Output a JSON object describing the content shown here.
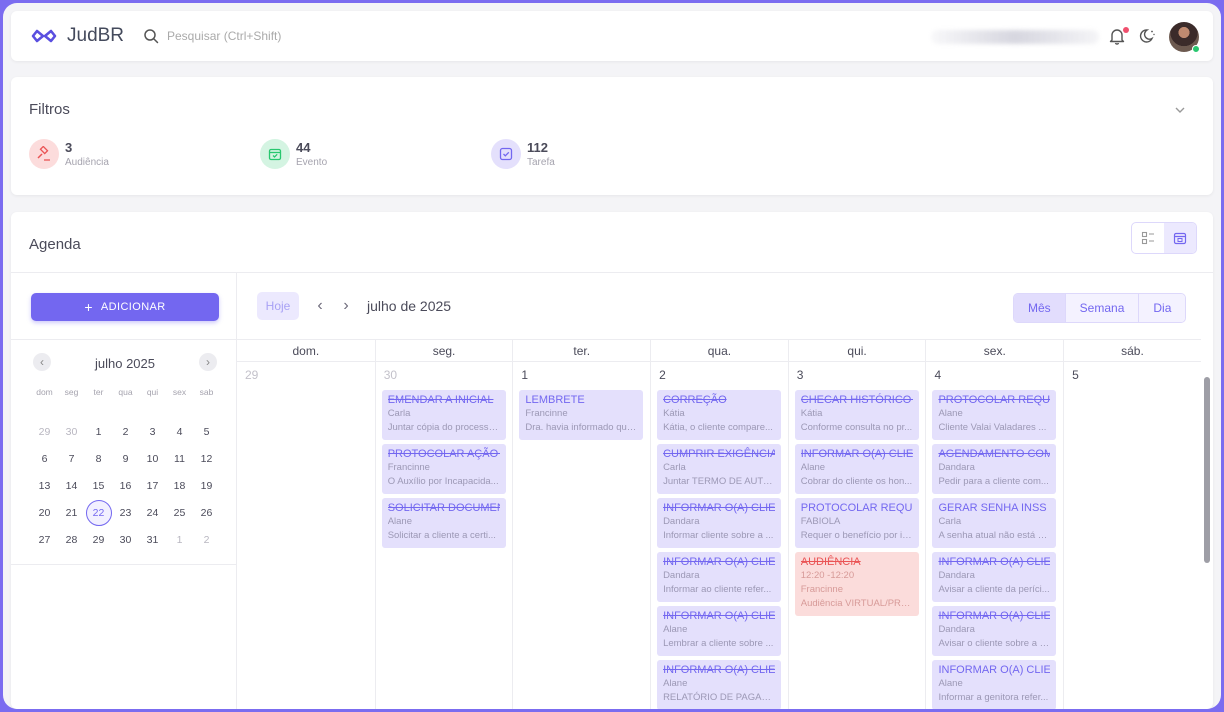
{
  "header": {
    "app_name": "JudBR",
    "search_placeholder": "Pesquisar (Ctrl+Shift)"
  },
  "filters": {
    "title": "Filtros",
    "stats": [
      {
        "count": "3",
        "label": "Audiência",
        "color": "#ea5455"
      },
      {
        "count": "44",
        "label": "Evento",
        "color": "#28c76f"
      },
      {
        "count": "112",
        "label": "Tarefa",
        "color": "#7367f0"
      }
    ]
  },
  "agenda": {
    "title": "Agenda",
    "add_label": "ADICIONAR",
    "mini_calendar": {
      "title": "julho 2025",
      "weekdays": [
        "dom",
        "seg",
        "ter",
        "qua",
        "qui",
        "sex",
        "sab"
      ],
      "weeks": [
        [
          "29",
          "30",
          "1",
          "2",
          "3",
          "4",
          "5"
        ],
        [
          "6",
          "7",
          "8",
          "9",
          "10",
          "11",
          "12"
        ],
        [
          "13",
          "14",
          "15",
          "16",
          "17",
          "18",
          "19"
        ],
        [
          "20",
          "21",
          "22",
          "23",
          "24",
          "25",
          "26"
        ],
        [
          "27",
          "28",
          "29",
          "30",
          "31",
          "1",
          "2"
        ]
      ],
      "selected_day": "22"
    },
    "toolbar": {
      "today_label": "Hoje",
      "month_title": "julho de 2025",
      "views": [
        "Mês",
        "Semana",
        "Dia"
      ],
      "active_view": "Mês"
    },
    "weekdays": [
      "dom.",
      "seg.",
      "ter.",
      "qua.",
      "qui.",
      "sex.",
      "sáb."
    ],
    "days": [
      {
        "num": "29",
        "muted": true,
        "events": []
      },
      {
        "num": "30",
        "muted": true,
        "events": [
          {
            "title": "EMENDAR A INICIAL",
            "person": "Carla",
            "desc": "Juntar cópia do processo...",
            "strike": true
          },
          {
            "title": "PROTOCOLAR AÇÃO J",
            "person": "Francinne",
            "desc": "O Auxílio por Incapacida...",
            "strike": true
          },
          {
            "title": "SOLICITAR DOCUMEN",
            "person": "Alane",
            "desc": "Solicitar a cliente a certi...",
            "strike": true
          }
        ]
      },
      {
        "num": "1",
        "muted": false,
        "events": [
          {
            "title": "LEMBRETE",
            "person": "Francinne",
            "desc": "Dra. havia informado que...",
            "strike": false
          }
        ]
      },
      {
        "num": "2",
        "muted": false,
        "events": [
          {
            "title": "CORREÇÃO",
            "person": "Kátia",
            "desc": "Kátia, o cliente compare...",
            "strike": true
          },
          {
            "title": "CUMPRIR EXIGÊNCIA",
            "person": "Carla",
            "desc": "Juntar TERMO DE AUTO...",
            "strike": true
          },
          {
            "title": "INFORMAR O(A) CLIEN",
            "person": "Dandara",
            "desc": "Informar cliente sobre a ...",
            "strike": true
          },
          {
            "title": "INFORMAR O(A) CLIEN",
            "person": "Dandara",
            "desc": "Informar ao cliente refer...",
            "strike": true
          },
          {
            "title": "INFORMAR O(A) CLIEN",
            "person": "Alane",
            "desc": "Lembrar a cliente sobre ...",
            "strike": true
          },
          {
            "title": "INFORMAR O(A) CLIEN",
            "person": "Alane",
            "desc": "RELATÓRIO DE PAGAME...",
            "strike": true
          }
        ]
      },
      {
        "num": "3",
        "muted": false,
        "events": [
          {
            "title": "CHECAR HISTÓRICO D",
            "person": "Kátia",
            "desc": "Conforme consulta no pr...",
            "strike": true
          },
          {
            "title": "INFORMAR O(A) CLIEN",
            "person": "Alane",
            "desc": "Cobrar do cliente os hon...",
            "strike": true
          },
          {
            "title": "PROTOCOLAR REQUE",
            "person": "FABIOLA",
            "desc": "Requer o benefício por in...",
            "strike": false
          },
          {
            "title": "AUDIÊNCIA",
            "time": "12:20 -12:20",
            "person": "Francinne",
            "desc": "Audiência VIRTUAL/PRE...",
            "strike": true,
            "red": true
          }
        ]
      },
      {
        "num": "4",
        "muted": false,
        "events": [
          {
            "title": "PROTOCOLAR REQUE",
            "person": "Alane",
            "desc": "Cliente Valai Valadares ...",
            "strike": true
          },
          {
            "title": "AGENDAMENTO COM",
            "person": "Dandara",
            "desc": "Pedir para a cliente com...",
            "strike": true
          },
          {
            "title": "GERAR SENHA INSS",
            "person": "Carla",
            "desc": "A senha atual não está e...",
            "strike": false
          },
          {
            "title": "INFORMAR O(A) CLIEN",
            "person": "Dandara",
            "desc": "Avisar a cliente da períci...",
            "strike": true
          },
          {
            "title": "INFORMAR O(A) CLIEN",
            "person": "Dandara",
            "desc": "Avisar o cliente sobre a a...",
            "strike": true
          },
          {
            "title": "INFORMAR O(A) CLIEN",
            "person": "Alane",
            "desc": "Informar a genitora refer...",
            "strike": false
          }
        ]
      },
      {
        "num": "5",
        "muted": false,
        "events": []
      }
    ]
  }
}
